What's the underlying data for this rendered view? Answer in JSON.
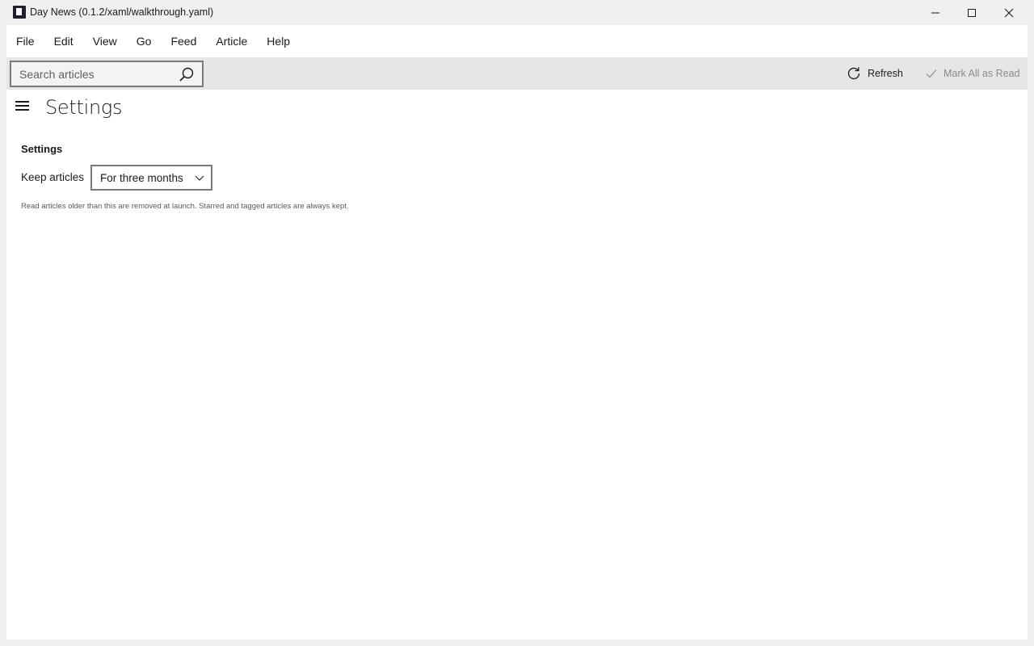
{
  "window": {
    "title": "Day News (0.1.2/xaml/walkthrough.yaml)"
  },
  "menu": {
    "items": [
      "File",
      "Edit",
      "View",
      "Go",
      "Feed",
      "Article",
      "Help"
    ]
  },
  "toolbar": {
    "search_placeholder": "Search articles",
    "refresh_label": "Refresh",
    "mark_all_read_label": "Mark All as Read"
  },
  "page": {
    "title": "Settings",
    "section_title": "Settings",
    "keep_articles_label": "Keep articles",
    "keep_articles_value": "For three months",
    "help_text": "Read articles older than this are removed at launch. Starred and tagged articles are always kept."
  },
  "colors": {
    "chrome_bg": "#f0f0f0",
    "toolbar_bg": "#e6e6e6",
    "content_bg": "#ffffff",
    "disabled_text": "#8a8a8a"
  }
}
